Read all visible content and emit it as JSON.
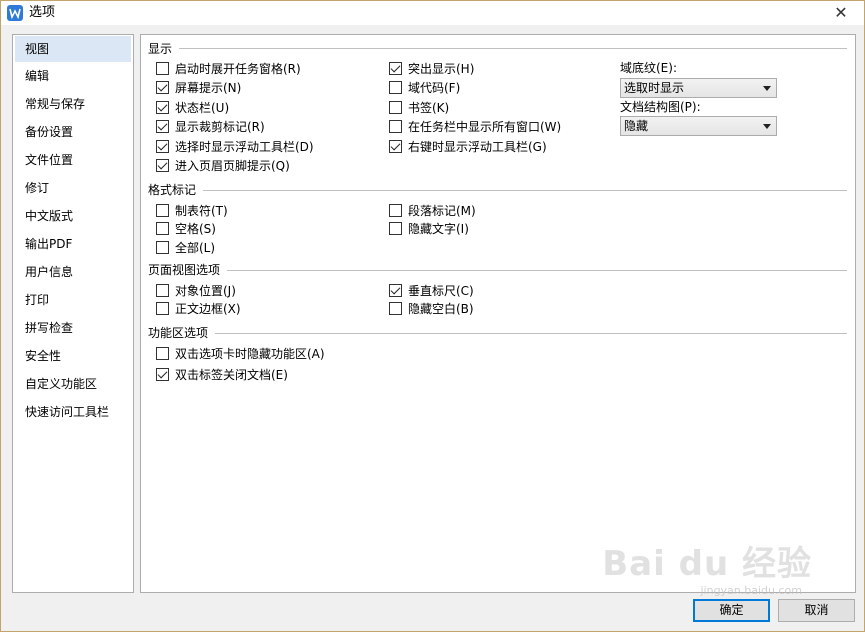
{
  "window": {
    "title": "选项",
    "close_glyph": "✕"
  },
  "sidebar": {
    "items": [
      {
        "label": "视图",
        "selected": true
      },
      {
        "label": "编辑"
      },
      {
        "label": "常规与保存"
      },
      {
        "label": "备份设置"
      },
      {
        "label": "文件位置"
      },
      {
        "label": "修订"
      },
      {
        "label": "中文版式"
      },
      {
        "label": "输出PDF"
      },
      {
        "label": "用户信息"
      },
      {
        "label": "打印"
      },
      {
        "label": "拼写检查"
      },
      {
        "label": "安全性"
      },
      {
        "label": "自定义功能区"
      },
      {
        "label": "快速访问工具栏"
      }
    ]
  },
  "display": {
    "title": "显示",
    "col1": [
      {
        "label": "启动时展开任务窗格(R)",
        "checked": false
      },
      {
        "label": "屏幕提示(N)",
        "checked": true
      },
      {
        "label": "状态栏(U)",
        "checked": true
      },
      {
        "label": "显示裁剪标记(R)",
        "checked": true
      },
      {
        "label": "选择时显示浮动工具栏(D)",
        "checked": true
      },
      {
        "label": "进入页眉页脚提示(Q)",
        "checked": true
      }
    ],
    "col2": [
      {
        "label": "突出显示(H)",
        "checked": true
      },
      {
        "label": "域代码(F)",
        "checked": false
      },
      {
        "label": "书签(K)",
        "checked": false
      },
      {
        "label": "在任务栏中显示所有窗口(W)",
        "checked": false
      },
      {
        "label": "右键时显示浮动工具栏(G)",
        "checked": true
      }
    ],
    "field_shading": {
      "label": "域底纹(E):",
      "value": "选取时显示"
    },
    "doc_map": {
      "label": "文档结构图(P):",
      "value": "隐藏"
    }
  },
  "format_marks": {
    "title": "格式标记",
    "col1": [
      {
        "label": "制表符(T)",
        "checked": false
      },
      {
        "label": "空格(S)",
        "checked": false
      },
      {
        "label": "全部(L)",
        "checked": false
      }
    ],
    "col2": [
      {
        "label": "段落标记(M)",
        "checked": false
      },
      {
        "label": "隐藏文字(I)",
        "checked": false
      }
    ]
  },
  "page_view": {
    "title": "页面视图选项",
    "col1": [
      {
        "label": "对象位置(J)",
        "checked": false
      },
      {
        "label": "正文边框(X)",
        "checked": false
      }
    ],
    "col2": [
      {
        "label": "垂直标尺(C)",
        "checked": true
      },
      {
        "label": "隐藏空白(B)",
        "checked": false
      }
    ]
  },
  "ribbon": {
    "title": "功能区选项",
    "items": [
      {
        "label": "双击选项卡时隐藏功能区(A)",
        "checked": false
      },
      {
        "label": "双击标签关闭文档(E)",
        "checked": true
      }
    ]
  },
  "buttons": {
    "ok": "确定",
    "cancel": "取消"
  },
  "watermark": {
    "text": "Bai du 经验",
    "sub": "jingyan.baidu.com"
  }
}
